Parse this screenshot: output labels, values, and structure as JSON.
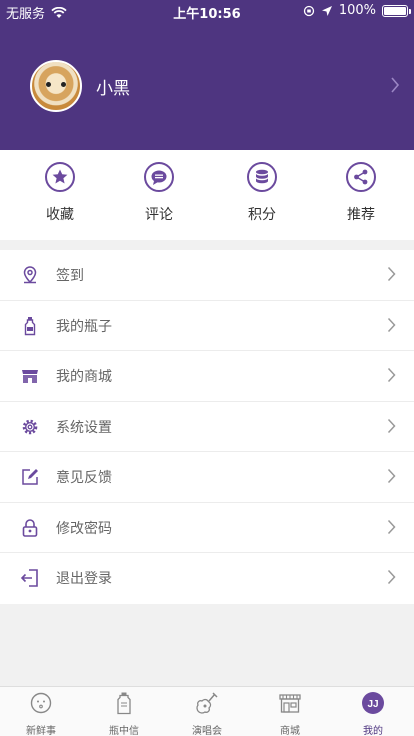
{
  "status_bar": {
    "carrier": "无服务",
    "time": "上午10:56",
    "battery": "100%"
  },
  "profile": {
    "name": "小黑"
  },
  "shortcuts": [
    {
      "label": "收藏",
      "icon": "star-icon"
    },
    {
      "label": "评论",
      "icon": "comment-icon"
    },
    {
      "label": "积分",
      "icon": "coins-icon"
    },
    {
      "label": "推荐",
      "icon": "share-icon"
    }
  ],
  "menu": [
    {
      "label": "签到",
      "icon": "location-pin-icon"
    },
    {
      "label": "我的瓶子",
      "icon": "bottle-icon"
    },
    {
      "label": "我的商城",
      "icon": "store-icon"
    },
    {
      "label": "系统设置",
      "icon": "gear-icon"
    },
    {
      "label": "意见反馈",
      "icon": "edit-icon"
    },
    {
      "label": "修改密码",
      "icon": "lock-icon"
    },
    {
      "label": "退出登录",
      "icon": "logout-icon"
    }
  ],
  "tabs": [
    {
      "label": "新鲜事",
      "icon": "smiley-icon"
    },
    {
      "label": "瓶中信",
      "icon": "bottle-letter-icon"
    },
    {
      "label": "演唱会",
      "icon": "guitar-icon"
    },
    {
      "label": "商城",
      "icon": "shop-icon"
    },
    {
      "label": "我的",
      "icon": "profile-badge-icon",
      "active": true
    }
  ],
  "colors": {
    "header": "#4e3580",
    "accent": "#6b4a9e",
    "background": "#f1f1f1"
  }
}
